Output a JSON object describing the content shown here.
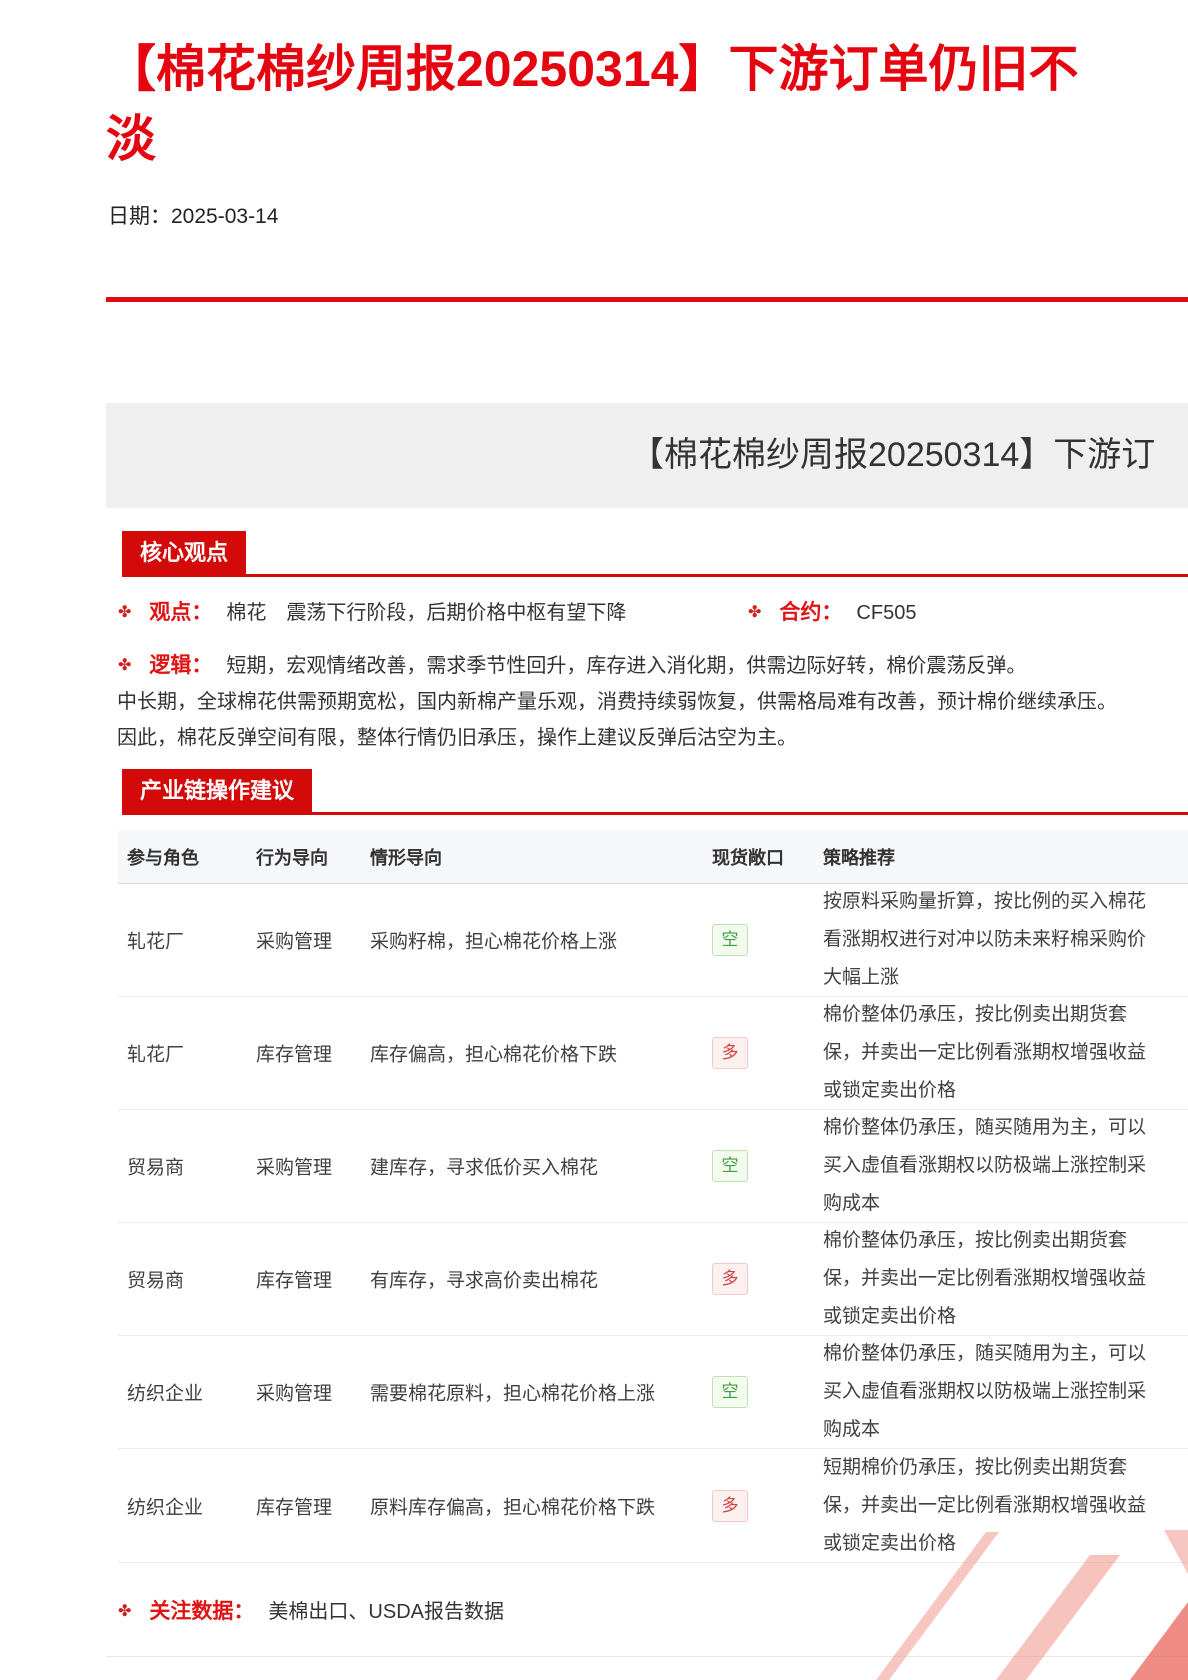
{
  "page": {
    "title_line1": "【棉花棉纱周报20250314】下游订单仍旧不",
    "title_line2": "淡",
    "date_label": "日期：",
    "date_value": "2025-03-14"
  },
  "banner": {
    "title_visible": "【棉花棉纱周报20250314】下游订"
  },
  "core": {
    "header": "核心观点",
    "bullet_icon": "✤",
    "viewpoint_label": "观点：",
    "viewpoint_text": "棉花　震荡下行阶段，后期价格中枢有望下降",
    "contract_label": "合约：",
    "contract_value": "CF505",
    "logic_label": "逻辑：",
    "logic_line1": "短期，宏观情绪改善，需求季节性回升，库存进入消化期，供需边际好转，棉价震荡反弹。",
    "logic_line2": "中长期，全球棉花供需预期宽松，国内新棉产量乐观，消费持续弱恢复，供需格局难有改善，预计棉价继续承压。",
    "logic_line3": "因此，棉花反弹空间有限，整体行情仍旧承压，操作上建议反弹后沽空为主。"
  },
  "chain": {
    "header": "产业链操作建议",
    "table": {
      "columns": [
        "参与角色",
        "行为导向",
        "情形导向",
        "现货敞口",
        "策略推荐"
      ],
      "rows": [
        {
          "role": "轧花厂",
          "behavior": "采购管理",
          "scenario": "采购籽棉，担心棉花价格上涨",
          "exposure": "空",
          "exposure_type": "short",
          "strategy_lines": [
            "按原料采购量折算，按比例的买入棉花",
            "看涨期权进行对冲以防未来籽棉采购价",
            "大幅上涨"
          ]
        },
        {
          "role": "轧花厂",
          "behavior": "库存管理",
          "scenario": "库存偏高，担心棉花价格下跌",
          "exposure": "多",
          "exposure_type": "long",
          "strategy_lines": [
            "棉价整体仍承压，按比例卖出期货套",
            "保，并卖出一定比例看涨期权增强收益",
            "或锁定卖出价格"
          ]
        },
        {
          "role": "贸易商",
          "behavior": "采购管理",
          "scenario": "建库存，寻求低价买入棉花",
          "exposure": "空",
          "exposure_type": "short",
          "strategy_lines": [
            "棉价整体仍承压，随买随用为主，可以",
            "买入虚值看涨期权以防极端上涨控制采",
            "购成本"
          ]
        },
        {
          "role": "贸易商",
          "behavior": "库存管理",
          "scenario": "有库存，寻求高价卖出棉花",
          "exposure": "多",
          "exposure_type": "long",
          "strategy_lines": [
            "棉价整体仍承压，按比例卖出期货套",
            "保，并卖出一定比例看涨期权增强收益",
            "或锁定卖出价格"
          ]
        },
        {
          "role": "纺织企业",
          "behavior": "采购管理",
          "scenario": "需要棉花原料，担心棉花价格上涨",
          "exposure": "空",
          "exposure_type": "short",
          "strategy_lines": [
            "棉价整体仍承压，随买随用为主，可以",
            "买入虚值看涨期权以防极端上涨控制采",
            "购成本"
          ]
        },
        {
          "role": "纺织企业",
          "behavior": "库存管理",
          "scenario": "原料库存偏高，担心棉花价格下跌",
          "exposure": "多",
          "exposure_type": "long",
          "strategy_lines": [
            "短期棉价仍承压，按比例卖出期货套",
            "保，并卖出一定比例看涨期权增强收益",
            "或锁定卖出价格"
          ]
        }
      ]
    }
  },
  "footer": {
    "bullet_icon": "✤",
    "focus_label": "关注数据：",
    "focus_text": "美棉出口、USDA报告数据"
  },
  "colors": {
    "title_red": "#e50510",
    "section_red": "#d40a0a",
    "banner_bg": "#efefef",
    "short_green": "#3f9f3f",
    "long_red": "#d04040"
  }
}
